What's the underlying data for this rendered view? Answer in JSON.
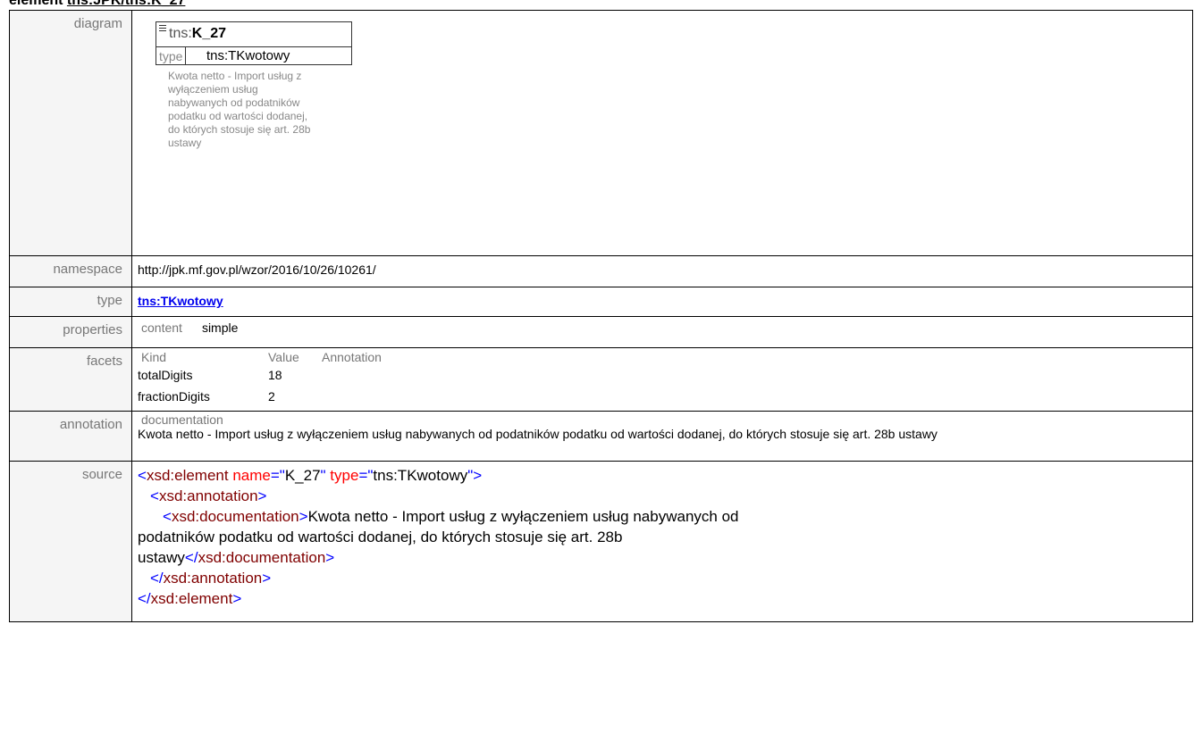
{
  "heading": {
    "prefix": "element ",
    "link": "tns:JPK/tns:K_27"
  },
  "labels": {
    "diagram": "diagram",
    "namespace": "namespace",
    "type": "type",
    "properties": "properties",
    "facets": "facets",
    "annotation": "annotation",
    "source": "source"
  },
  "diagram": {
    "prefix": "tns:",
    "name": "K_27",
    "type_label": "type",
    "type_value": "tns:TKwotowy",
    "note": "Kwota netto - Import usług z wyłączeniem usług nabywanych od podatników podatku od wartości dodanej, do których stosuje się art. 28b ustawy"
  },
  "namespace": "http://jpk.mf.gov.pl/wzor/2016/10/26/10261/",
  "type": "tns:TKwotowy",
  "properties": {
    "key": "content",
    "value": "simple"
  },
  "facets": {
    "headers": [
      "Kind",
      "Value",
      "Annotation"
    ],
    "rows": [
      {
        "kind": "totalDigits",
        "value": "18"
      },
      {
        "kind": "fractionDigits",
        "value": "2"
      }
    ]
  },
  "annotation": {
    "header": "documentation",
    "text": "Kwota netto - Import usług z wyłączeniem usług nabywanych od podatników podatku od wartości dodanej, do których stosuje się art. 28b ustawy"
  },
  "source": {
    "line1": {
      "open": "<",
      "tag": "xsd:element",
      "attr1": " name",
      "eq1": "=\"",
      "val1": "K_27",
      "q1": "\"",
      "attr2": " type",
      "eq2": "=\"",
      "val2": "tns:TKwotowy",
      "q2": "\"",
      "close": ">"
    },
    "line2": {
      "open": "<",
      "tag": "xsd:annotation",
      "close": ">"
    },
    "line3": {
      "open": "<",
      "tag": "xsd:documentation",
      "close": ">",
      "text": "Kwota netto - Import usług z wyłączeniem usług nabywanych od"
    },
    "line4": "podatników podatku od wartości dodanej, do których stosuje się art. 28b",
    "line5": {
      "text": "ustawy",
      "open": "</",
      "tag": "xsd:documentation",
      "close": ">"
    },
    "line6": {
      "open": "</",
      "tag": "xsd:annotation",
      "close": ">"
    },
    "line7": {
      "open": "</",
      "tag": "xsd:element",
      "close": ">"
    }
  }
}
